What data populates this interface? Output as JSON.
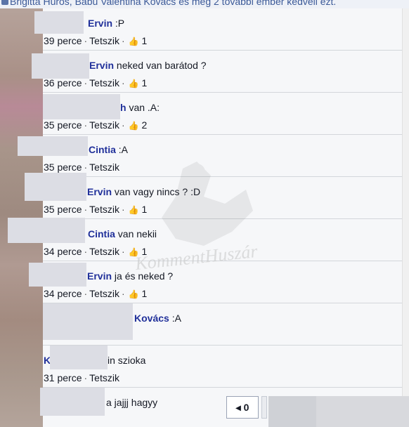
{
  "likes_text": "Brigitta Hüros, Babu Valentina Kovács és még 2 további ember kedveli ezt.",
  "like_label": "Tetszik",
  "separator": "·",
  "thumb_glyph": "👍",
  "comments": [
    {
      "name": "Ervin",
      "text": " :P",
      "time": "39 perce",
      "likes": "1"
    },
    {
      "name": "Ervin",
      "text": " neked van barátod ?",
      "time": "36 perce",
      "likes": "1"
    },
    {
      "name": "h",
      "text": " van .A:",
      "time": "35 perce",
      "likes": "2"
    },
    {
      "name": "Cintia",
      "text": " :A",
      "time": "35 perce",
      "likes": ""
    },
    {
      "name": "Ervin",
      "text": " van vagy nincs ? :D",
      "time": "35 perce",
      "likes": "1"
    },
    {
      "name": "Cintia",
      "text": " van nekii",
      "time": "34 perce",
      "likes": "1"
    },
    {
      "name": "Ervin",
      "text": " ja és neked ?",
      "time": "34 perce",
      "likes": "1"
    },
    {
      "name": "Kovács",
      "text": " :A",
      "time": "",
      "likes": ""
    },
    {
      "name": "K",
      "text": "in szioka",
      "time": "31 perce",
      "likes": ""
    },
    {
      "name": "",
      "text": "a jajjj hagyy",
      "time": "",
      "likes": ""
    }
  ],
  "watermark": "KommentHuszár",
  "chat": {
    "count": "0"
  }
}
